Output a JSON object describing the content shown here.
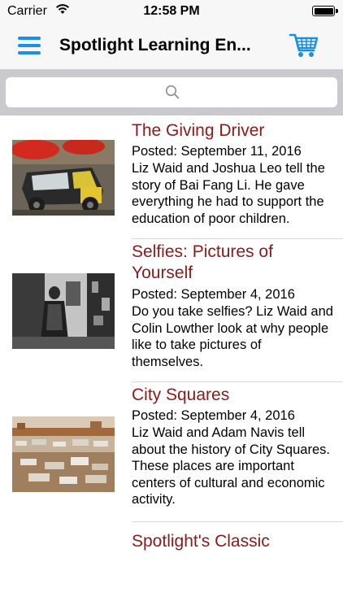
{
  "status_bar": {
    "carrier": "Carrier",
    "time": "12:58 PM"
  },
  "nav": {
    "title": "Spotlight Learning En...",
    "menu_icon": "hamburger-menu-icon",
    "cart_icon": "shopping-cart-icon",
    "accent_color": "#1a8fe3"
  },
  "search": {
    "placeholder": "",
    "icon": "search-icon"
  },
  "articles": [
    {
      "title": "The Giving Driver",
      "posted": "Posted: September 11, 2016",
      "summary": "Liz Waid and Joshua Leo tell the story of Bai Fang Li. He gave everything he had to support the education of poor children."
    },
    {
      "title": "Selfies: Pictures of Yourself",
      "posted": "Posted: September 4, 2016",
      "summary": "Do you take selfies? Liz Waid and Colin Lowther look at why people like to take pictures of themselves."
    },
    {
      "title": "City Squares",
      "posted": "Posted: September 4, 2016",
      "summary": "Liz Waid and Adam Navis tell about the history of City Squares. These places are important centers of cultural and economic activity."
    },
    {
      "title": "Spotlight's Classic",
      "posted": "",
      "summary": ""
    }
  ],
  "colors": {
    "title_color": "#8b1a1a"
  }
}
